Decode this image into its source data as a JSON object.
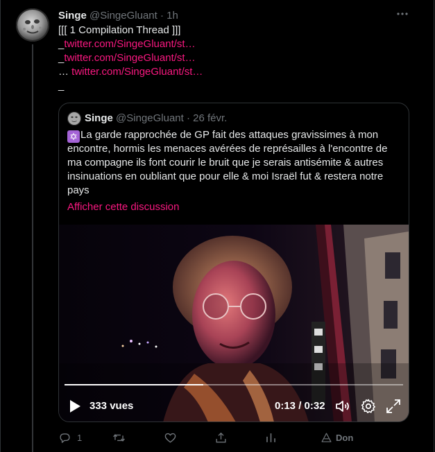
{
  "tweet": {
    "author_name": "Singe",
    "author_handle": "@SingeGluant",
    "separator": "·",
    "time": "1h",
    "lines": {
      "title": "[[[ 1 Compilation Thread ]]]",
      "link1_prefix": "_",
      "link1": "twitter.com/SingeGluant/st…",
      "link2_prefix": "_",
      "link2": "twitter.com/SingeGluant/st…",
      "link3_prefix": "… ",
      "link3": "twitter.com/SingeGluant/st…",
      "trail": "_"
    }
  },
  "quote": {
    "author_name": "Singe",
    "author_handle": "@SingeGluant",
    "separator": "·",
    "date": "26 févr.",
    "emoji": "✡",
    "text_lines": [
      "La garde rapprochée de GP fait des attaques gravissimes à mon",
      "encontre, hormis les menaces avérées de représailles à l'encontre de",
      "ma compagne ils font courir le bruit que je serais antisémite & autres",
      "insinuations en oubliant que pour elle & moi Israël fut & restera notre",
      "pays"
    ],
    "show_thread": "Afficher cette discussion",
    "video": {
      "views": "333 vues",
      "time": "0:13 / 0:32",
      "progress": 0.41
    }
  },
  "actions": {
    "reply_count": "1",
    "donate_label": "Don"
  },
  "icons": {
    "more": "more-icon",
    "reply": "reply-icon",
    "retweet": "retweet-icon",
    "like": "like-icon",
    "share": "share-icon",
    "analytics": "analytics-icon",
    "donate": "donate-icon"
  },
  "colors": {
    "accent": "#f91880",
    "muted": "#71767b",
    "text": "#e7e9ea",
    "border": "#2f3336"
  }
}
